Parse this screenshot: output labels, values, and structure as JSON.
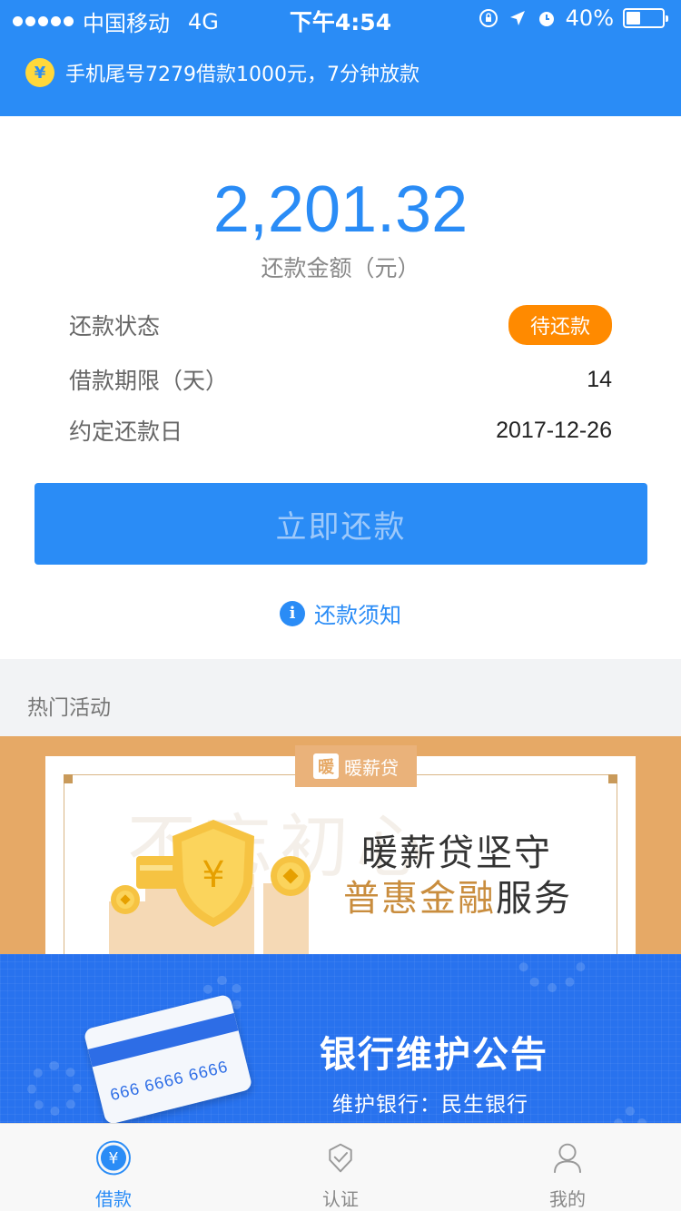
{
  "status_bar": {
    "carrier": "中国移动",
    "network": "4G",
    "time": "下午4:54",
    "battery": "40%",
    "battery_level": 0.4
  },
  "notice": {
    "icon": "yen-coin-icon",
    "text": "手机尾号7279借款1000元，7分钟放款"
  },
  "repayment": {
    "amount": "2,201.32",
    "amount_label": "还款金额（元）",
    "rows": [
      {
        "label": "还款状态",
        "value": "待还款"
      },
      {
        "label": "借款期限（天）",
        "value": "14"
      },
      {
        "label": "约定还款日",
        "value": "2017-12-26"
      }
    ],
    "button": "立即还款",
    "info_link": "还款须知"
  },
  "section_title": "热门活动",
  "banner1": {
    "logo_text": "暖薪贷",
    "logo_mark": "暖",
    "watermark": "不忘初心",
    "line1": "暖薪贷坚守",
    "line2_highlight": "普惠金融",
    "line2_rest": "服务"
  },
  "banner2": {
    "title": "银行维护公告",
    "subtitle": "维护银行：民生银行",
    "card_numbers": "666 6666 6666"
  },
  "tabbar": [
    {
      "label": "借款",
      "icon": "yen-circle-icon",
      "active": true
    },
    {
      "label": "认证",
      "icon": "badge-check-icon",
      "active": false
    },
    {
      "label": "我的",
      "icon": "user-icon",
      "active": false
    }
  ],
  "colors": {
    "primary": "#2a8cf6",
    "status_badge": "#ff8a00",
    "banner1_bg": "#e6a966",
    "banner2_bg": "#2872ee"
  }
}
